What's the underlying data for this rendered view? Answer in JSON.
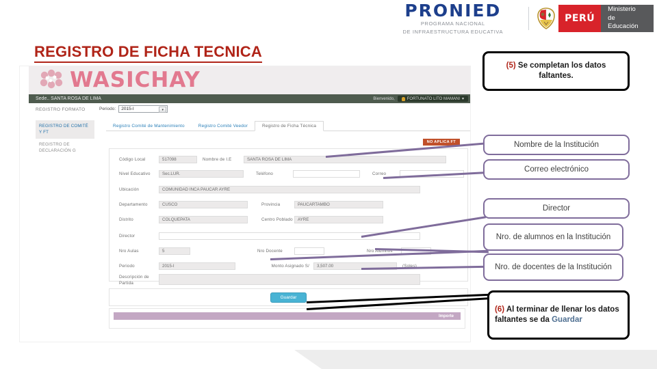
{
  "header": {
    "pronied_word": "PRONIED",
    "pronied_sub_line1": "PROGRAMA NACIONAL",
    "pronied_sub_line2": "DE INFRAESTRUCTURA EDUCATIVA",
    "peru_label": "PERÚ",
    "ministry_line1": "Ministerio",
    "ministry_line2": "de Educación"
  },
  "slide": {
    "title": "REGISTRO DE FICHA TECNICA"
  },
  "app": {
    "brand": "WASICHAY",
    "sede": "Sede.. SANTA ROSA DE LIMA",
    "welcome": "Bienvenido,",
    "user": "FORTUNATO LITO MAMANI",
    "breadcrumb": "REGISTRO FORMATO",
    "periodo_label": "Periodo:",
    "periodo_value": "2015-I",
    "sidebar": [
      {
        "label": "REGISTRO DE COMITÉ Y FT",
        "state": "active"
      },
      {
        "label": "REGISTRO DE DECLARACIÓN G",
        "state": "idle"
      }
    ],
    "tabs": [
      {
        "label": "Registro Comité de Mantenimiento",
        "selected": false
      },
      {
        "label": "Registro Comité Veedor",
        "selected": false
      },
      {
        "label": "Registro de Ficha Técnica",
        "selected": true
      }
    ],
    "badge_no_aplica": "NO APLICA FT",
    "form": {
      "codigo_local_label": "Código Local",
      "codigo_local_value": "517098",
      "nombre_ie_label": "Nombre de I.E",
      "nombre_ie_value": "SANTA ROSA DE LIMA",
      "nivel_label": "Nivel Educativo",
      "nivel_value": "Sec.LUR.",
      "telefono_label": "Teléfono",
      "telefono_value": "",
      "correo_label": "Correo",
      "correo_value": "",
      "ubicacion_label": "Ubicación",
      "ubicacion_value": "COMUNIDAD INCA PAUCAR AYRE",
      "departamento_label": "Departamento",
      "departamento_value": "CUSCO",
      "provincia_label": "Provincia",
      "provincia_value": "PAUCARTAMBO",
      "distrito_label": "Distrito",
      "distrito_value": "COLQUEPATA",
      "centro_poblado_label": "Centro Poblado",
      "centro_poblado_value": "AYRE",
      "director_label": "Director",
      "director_value": "",
      "nro_aulas_label": "Nro Aulas",
      "nro_aulas_value": "5",
      "nro_docente_label": "Nro Docente",
      "nro_docente_value": "",
      "nro_alumnos_label": "Nro Alumnos",
      "nro_alumnos_value": "",
      "periodo_f_label": "Periodo",
      "periodo_f_value": "2015-I",
      "monto_label": "Monto Asignado S/",
      "monto_value": "3,507.00",
      "monto_suffix": "(Soles)",
      "descripcion_label_1": "Descripción de",
      "descripcion_label_2": "Partida",
      "descripcion_value": ""
    },
    "guardar_button": "Guardar",
    "table_header_importe": "Importe"
  },
  "callouts": {
    "step5_num": "(5)",
    "step5_text": " Se completan los datos faltantes.",
    "nombre_institucion": "Nombre de la Institución",
    "correo_electronico": "Correo electrónico",
    "director": "Director",
    "nro_alumnos": "Nro. de alumnos en la Institución",
    "nro_docentes": "Nro. de docentes de la Institución",
    "step6_num": "(6)",
    "step6_text": " Al terminar de llenar los datos faltantes se da ",
    "step6_key": "Guardar"
  },
  "colors": {
    "title_red": "#b02418",
    "callout_purple": "#7f6c9b",
    "brand_pink": "#e2798f",
    "guardar_blue": "#49b3d4",
    "peru_red": "#d8232a"
  }
}
